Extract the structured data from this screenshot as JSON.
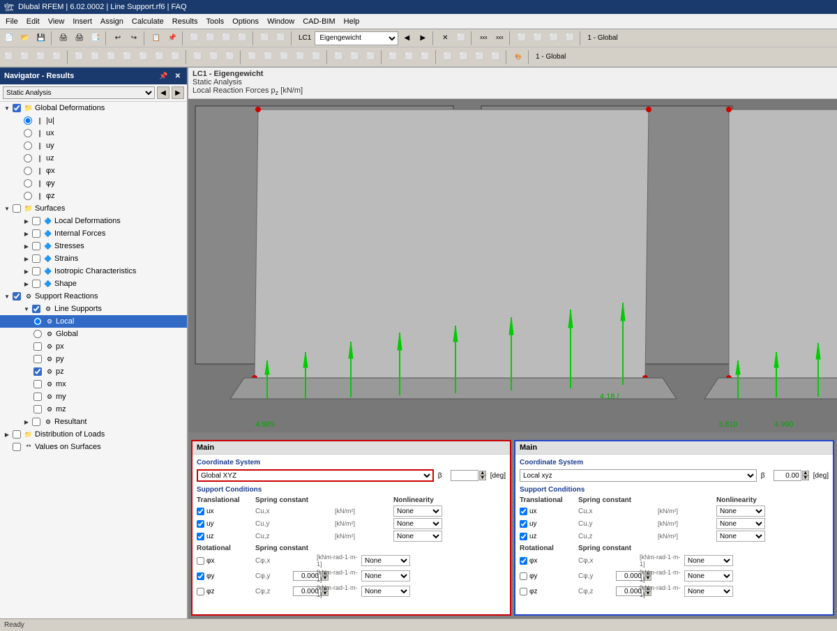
{
  "app": {
    "title": "Dlubal RFEM | 6.02.0002 | Line Support.rf6 | FAQ",
    "menu_items": [
      "File",
      "Edit",
      "View",
      "Insert",
      "Assign",
      "Calculate",
      "Results",
      "Tools",
      "Options",
      "Window",
      "CAD-BIM",
      "Help"
    ]
  },
  "toolbar": {
    "lc_dropdown": "LC1",
    "lc_name": "Eigengewicht",
    "view_label": "1 - Global"
  },
  "navigator": {
    "title": "Navigator - Results",
    "filter_label": "Static Analysis",
    "tree": {
      "global_deformations": {
        "label": "Global Deformations",
        "items": [
          "|u|",
          "ux",
          "uy",
          "uz",
          "φx",
          "φy",
          "φz"
        ]
      },
      "surfaces": {
        "label": "Surfaces",
        "children": {
          "local_deformations": "Local Deformations",
          "internal_forces": "Internal Forces",
          "stresses": "Stresses",
          "strains": "Strains",
          "isotropic_characteristics": "Isotropic Characteristics",
          "shape": "Shape"
        }
      },
      "support_reactions": {
        "label": "Support Reactions",
        "children": {
          "line_supports": {
            "label": "Line Supports",
            "items": {
              "local": "Local",
              "global": "Global",
              "px": "px",
              "py": "py",
              "pz": "pz",
              "mx": "mx",
              "my": "my",
              "mz": "mz"
            }
          },
          "resultant": "Resultant"
        }
      },
      "distribution_of_loads": "Distribution of Loads",
      "values_on_surfaces": "Values on Surfaces"
    }
  },
  "content": {
    "lc_label": "LC1 - Eigengewicht",
    "analysis_type": "Static Analysis",
    "result_label": "Local Reaction Forces p₂ [kN/m]",
    "left_value1": "4.989",
    "left_value2": "4.18 /",
    "right_value1": "3.810",
    "right_value2": "4.990"
  },
  "left_panel": {
    "title": "Main",
    "coordinate_system_label": "Coordinate System",
    "coordinate_system_value": "Global XYZ",
    "beta_label": "β",
    "beta_unit": "[deg]",
    "support_conditions_label": "Support Conditions",
    "translational_header": "Translational",
    "spring_header": "Spring constant",
    "nonlin_header": "Nonlinearity",
    "rows_translational": [
      {
        "check": true,
        "label": "ux",
        "spring": "Cu,x",
        "unit": "[kN/m²]",
        "nonlin": "None"
      },
      {
        "check": true,
        "label": "uy",
        "spring": "Cu,y",
        "unit": "[kN/m²]",
        "nonlin": "None"
      },
      {
        "check": true,
        "label": "uz",
        "spring": "Cu,z",
        "unit": "[kN/m²]",
        "nonlin": "None"
      }
    ],
    "rotational_header": "Rotational",
    "rows_rotational": [
      {
        "check": false,
        "label": "φx",
        "spring": "Cφ,x",
        "value": "",
        "unit": "[kNm-rad-1·m-1]",
        "nonlin": "None"
      },
      {
        "check": true,
        "label": "φy",
        "spring": "Cφ,y",
        "value": "0.000",
        "unit": "[kNm-rad-1·m-1]",
        "nonlin": "None"
      },
      {
        "check": false,
        "label": "φz",
        "spring": "Cφ,z",
        "value": "0.000",
        "unit": "[kNm-rad-1·m-1]",
        "nonlin": "None"
      }
    ]
  },
  "right_panel": {
    "title": "Main",
    "coordinate_system_label": "Coordinate System",
    "coordinate_system_value": "Local xyz",
    "beta_label": "β",
    "beta_value": "0.00",
    "beta_unit": "[deg]",
    "support_conditions_label": "Support Conditions",
    "translational_header": "Translational",
    "spring_header": "Spring constant",
    "nonlin_header": "Nonlinearity",
    "rows_translational": [
      {
        "check": true,
        "label": "ux",
        "spring": "Cu,x",
        "unit": "[kN/m²]",
        "nonlin": "None"
      },
      {
        "check": true,
        "label": "uy",
        "spring": "Cu,y",
        "unit": "[kN/m²]",
        "nonlin": "None"
      },
      {
        "check": true,
        "label": "uz",
        "spring": "Cu,z",
        "unit": "[kN/m²]",
        "nonlin": "None"
      }
    ],
    "rotational_header": "Rotational",
    "rows_rotational": [
      {
        "check": true,
        "label": "φx",
        "spring": "Cφ,x",
        "value": "",
        "unit": "[kNm-rad-1·m-1]",
        "nonlin": "None"
      },
      {
        "check": false,
        "label": "φy",
        "spring": "Cφ,y",
        "value": "0.000",
        "unit": "[kNm-rad-1·m-1]",
        "nonlin": "None"
      },
      {
        "check": false,
        "label": "φz",
        "spring": "Cφ,z",
        "value": "0.000",
        "unit": "[kNm-rad-1·m-1]",
        "nonlin": "None"
      }
    ]
  },
  "icons": {
    "expand": "▶",
    "collapse": "▼",
    "expand_small": "▸",
    "collapse_small": "▾",
    "folder": "📁",
    "gear": "⚙",
    "close": "✕",
    "arrow_up": "▲",
    "arrow_down": "▼",
    "spin_up": "▲",
    "spin_down": "▼"
  },
  "colors": {
    "accent_blue": "#1a3a6e",
    "selection": "#316AC5",
    "red_border": "#cc0000",
    "blue_border": "#2244cc",
    "green_arrow": "#00cc00",
    "toolbar_bg": "#d4d0c8"
  }
}
